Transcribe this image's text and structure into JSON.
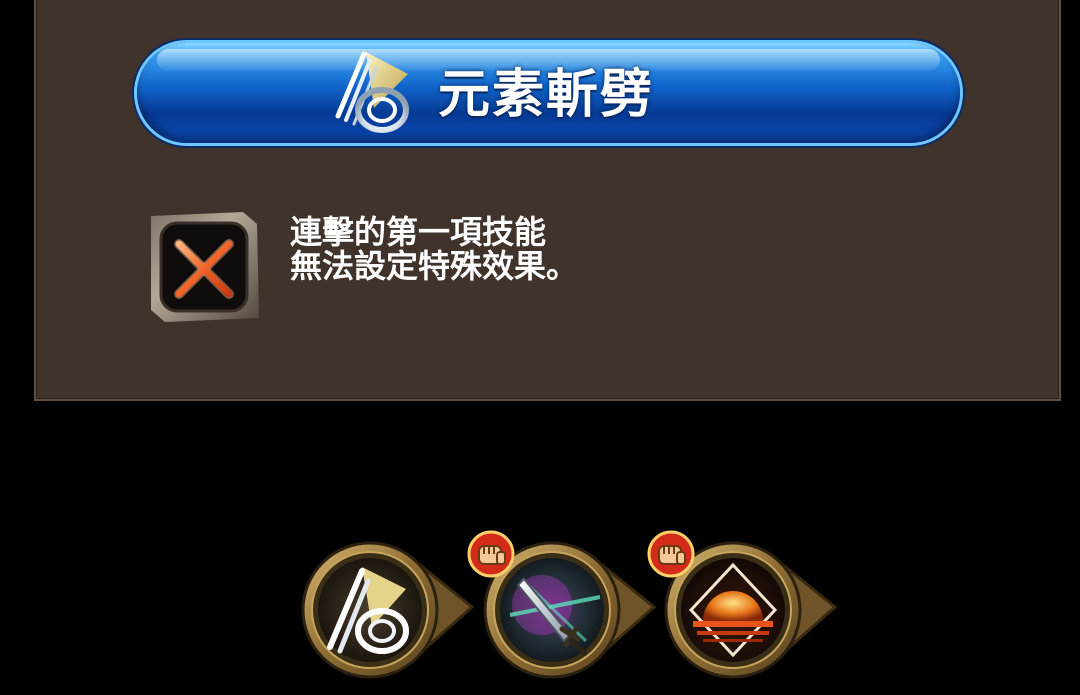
{
  "title_bar": {
    "label": "元素斬劈",
    "icon": "elemental-slash-icon"
  },
  "notice": {
    "icon": "disabled-x-icon",
    "line1": "連擊的第一項技能",
    "line2": "無法設定特殊效果。"
  },
  "skill_slots": [
    {
      "icon": "elemental-slash-icon",
      "selected": true
    },
    {
      "icon": "sword-skill-icon",
      "badge": "fist-icon"
    },
    {
      "icon": "fire-dome-skill-icon",
      "badge": "fist-icon"
    }
  ],
  "colors": {
    "panel_bg": "#3f332c",
    "title_bar_blue": "#0f62c8",
    "x_orange": "#f0642a",
    "gold_frame": "#8c6c34"
  }
}
